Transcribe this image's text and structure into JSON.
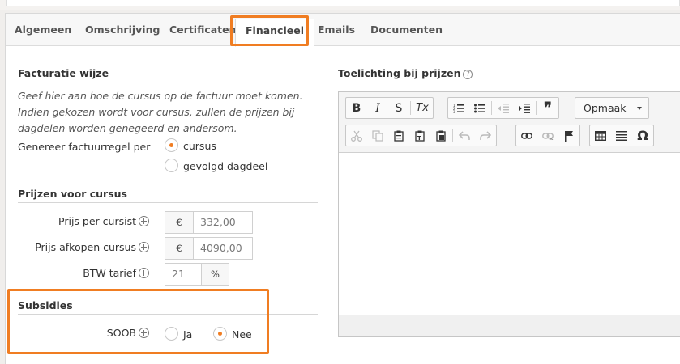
{
  "tabs": [
    "Algemeen",
    "Omschrijving",
    "Certificaten",
    "Financieel",
    "Emails",
    "Documenten"
  ],
  "active_tab": "Financieel",
  "accent_color": "#f07d22",
  "facturatie": {
    "title": "Facturatie wijze",
    "note": "Geef hier aan hoe de cursus op de factuur moet komen. Indien gekozen wordt voor cursus, zullen de prijzen bij dagdelen worden genegeerd en andersom.",
    "label": "Genereer factuurregel per",
    "options": [
      "cursus",
      "gevolgd dagdeel"
    ],
    "selected": "cursus"
  },
  "prijzen": {
    "title": "Prijzen voor cursus",
    "per_cursist_label": "Prijs per cursist",
    "per_cursist_currency": "€",
    "per_cursist_value": "332,00",
    "afkopen_label": "Prijs afkopen cursus",
    "afkopen_currency": "€",
    "afkopen_value": "4090,00",
    "btw_label": "BTW tarief",
    "btw_value": "21",
    "btw_unit": "%"
  },
  "subsidies": {
    "title": "Subsidies",
    "soob_label": "SOOB",
    "options": [
      "Ja",
      "Nee"
    ],
    "selected": "Nee"
  },
  "editor": {
    "title": "Toelichting bij prijzen",
    "help_icon": "?",
    "format_combo": "Opmaak",
    "buttons": {
      "bold": "B",
      "italic": "I",
      "strike": "S",
      "remove_format": "Tx",
      "blockquote": "❞",
      "special_char": "Ω"
    }
  }
}
